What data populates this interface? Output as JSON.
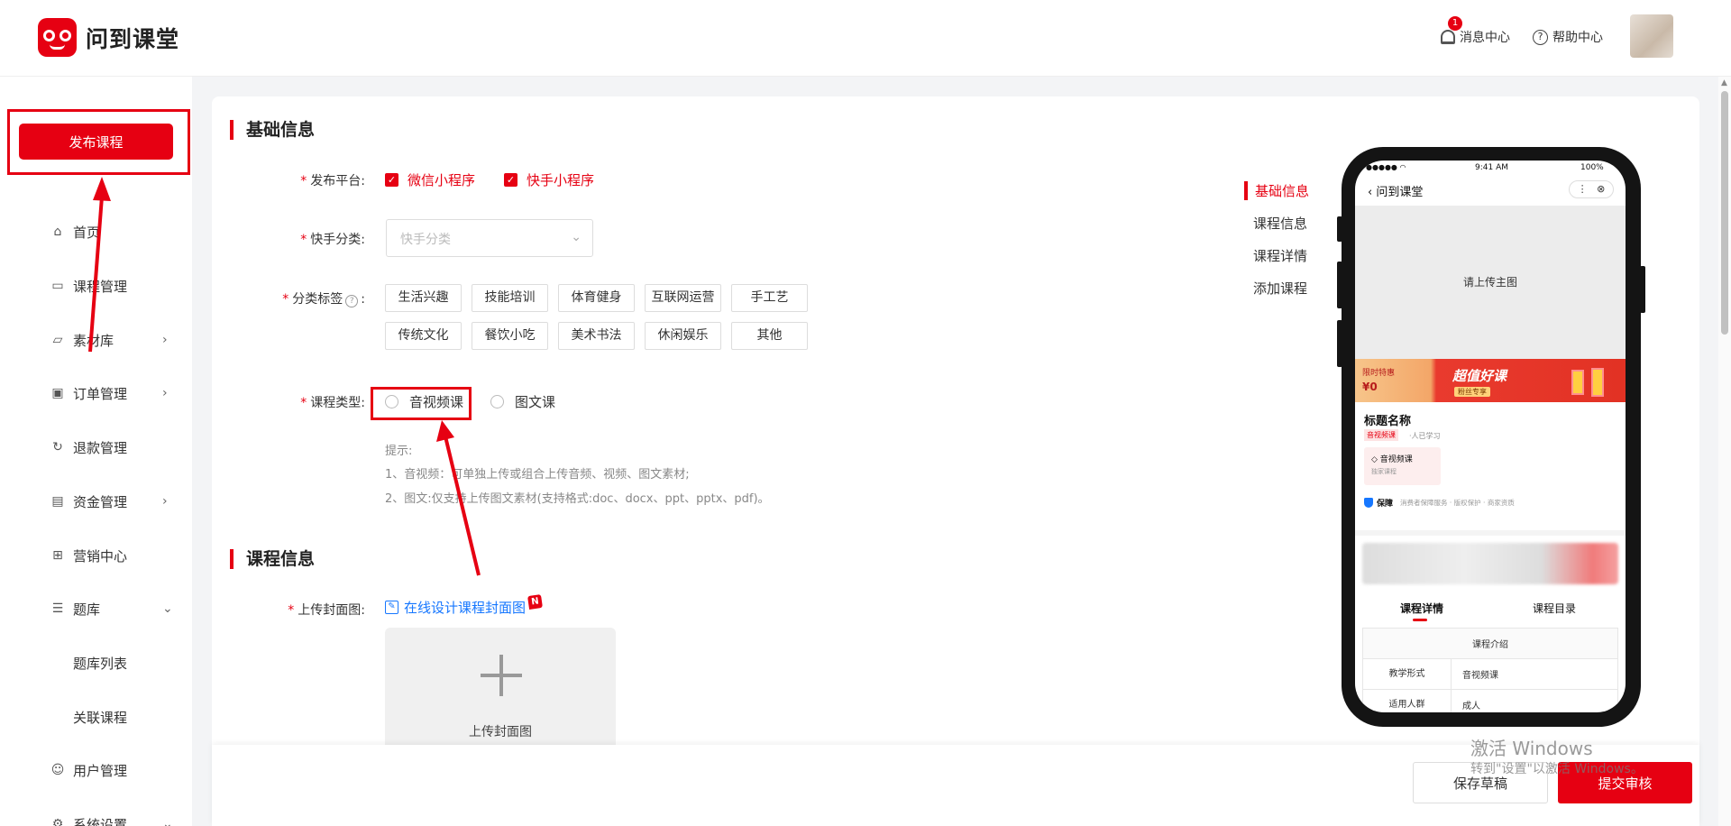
{
  "app": {
    "name": "问到课堂"
  },
  "header": {
    "badge_count": "1",
    "messages_label": "消息中心",
    "help_label": "帮助中心"
  },
  "sidebar": {
    "publish_label": "发布课程",
    "items": [
      {
        "label": "首页",
        "icon": "home-icon",
        "chevron": ""
      },
      {
        "label": "课程管理",
        "icon": "chat-icon",
        "chevron": ""
      },
      {
        "label": "素材库",
        "icon": "folder-icon",
        "chevron": "›"
      },
      {
        "label": "订单管理",
        "icon": "monitor-icon",
        "chevron": "›"
      },
      {
        "label": "退款管理",
        "icon": "refund-icon",
        "chevron": ""
      },
      {
        "label": "资金管理",
        "icon": "wallet-icon",
        "chevron": "›"
      },
      {
        "label": "营销中心",
        "icon": "gift-icon",
        "chevron": ""
      },
      {
        "label": "题库",
        "icon": "list-icon",
        "chevron": "⌄"
      },
      {
        "label": "题库列表",
        "icon": "",
        "chevron": ""
      },
      {
        "label": "关联课程",
        "icon": "",
        "chevron": ""
      },
      {
        "label": "用户管理",
        "icon": "user-icon",
        "chevron": ""
      },
      {
        "label": "系统设置",
        "icon": "gear-icon",
        "chevron": "⌄"
      }
    ]
  },
  "basic": {
    "title": "基础信息",
    "platform_label": "发布平台:",
    "platforms": [
      "微信小程序",
      "快手小程序"
    ],
    "category_label": "快手分类:",
    "category_placeholder": "快手分类",
    "tags_label": "分类标签",
    "tags": [
      "生活兴趣",
      "技能培训",
      "体育健身",
      "互联网运营",
      "手工艺",
      "传统文化",
      "餐饮小吃",
      "美术书法",
      "休闲娱乐",
      "其他"
    ],
    "type_label": "课程类型:",
    "types": [
      "音视频课",
      "图文课"
    ],
    "tips": [
      "提示:",
      "1、音视频：可单独上传或组合上传音频、视频、图文素材;",
      "2、图文:仅支持上传图文素材(支持格式:doc、docx、ppt、pptx、pdf)。"
    ]
  },
  "course": {
    "title": "课程信息",
    "cover_label": "上传封面图:",
    "design_link": "在线设计课程封面图",
    "design_badge": "N",
    "upload_label": "上传封面图"
  },
  "anchors": [
    "基础信息",
    "课程信息",
    "课程详情",
    "添加课程"
  ],
  "preview": {
    "status_time": "9:41 AM",
    "status_battery": "100%",
    "page_title": "问到课堂",
    "main_image": "请上传主图",
    "promo_label": "限时特惠",
    "promo_price": "¥0",
    "promo_title": "超值好课",
    "promo_sub": "粉丝专享",
    "course_name": "标题名称",
    "course_tag": "音视频课",
    "learners": "·人已学习",
    "card_title": "音视频课",
    "card_sub": "独家课程",
    "guarantee": "保障",
    "guarantee_detail": "消费者保障服务 · 版权保护 · 商家资质",
    "tabs": [
      "课程详情",
      "课程目录"
    ],
    "table_header": "课程介绍",
    "rows": [
      {
        "k": "教学形式",
        "v": "音视频课"
      },
      {
        "k": "适用人群",
        "v": "成人"
      }
    ]
  },
  "footer": {
    "draft_label": "保存草稿",
    "submit_label": "提交审核"
  },
  "watermark": {
    "line1": "激活 Windows",
    "line2": "转到\"设置\"以激活 Windows。"
  },
  "colors": {
    "brand": "#e60012",
    "link": "#1677ff"
  }
}
